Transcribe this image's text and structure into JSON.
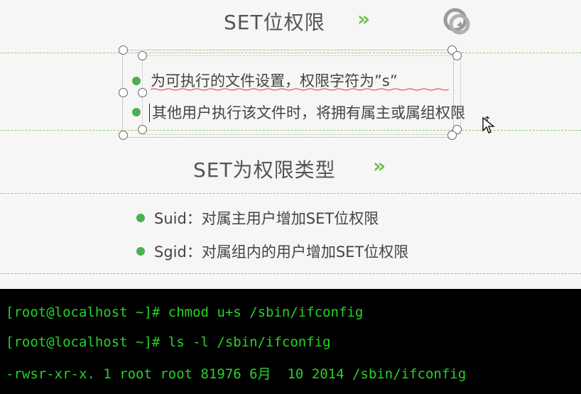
{
  "slide": {
    "title1": "SET位权限",
    "chevron1": "»",
    "bullets1": [
      "为可执行的文件设置，权限字符为”s”",
      "其他用户执行该文件时，将拥有属主或属组权限"
    ],
    "title2": "SET为权限类型",
    "chevron2": "»",
    "bullets2": [
      "Suid：对属主用户增加SET位权限",
      "Sgid：对属组内的用户增加SET位权限"
    ],
    "colors": {
      "accent_green": "#6ec046",
      "bullet_green": "#4caf50",
      "dash_green": "#8ecb6a",
      "text": "#444444"
    },
    "icons": [
      "refresh-icon",
      "move-cursor-icon"
    ]
  },
  "terminal": {
    "lines": [
      "[root@localhost ~]# chmod u+s /sbin/ifconfig",
      "[root@localhost ~]# ls -l /sbin/ifconfig",
      "-rwsr-xr-x. 1 root root 81976 6月  10 2014 /sbin/ifconfig"
    ],
    "colors": {
      "background": "#000000",
      "text": "#27d327"
    }
  }
}
